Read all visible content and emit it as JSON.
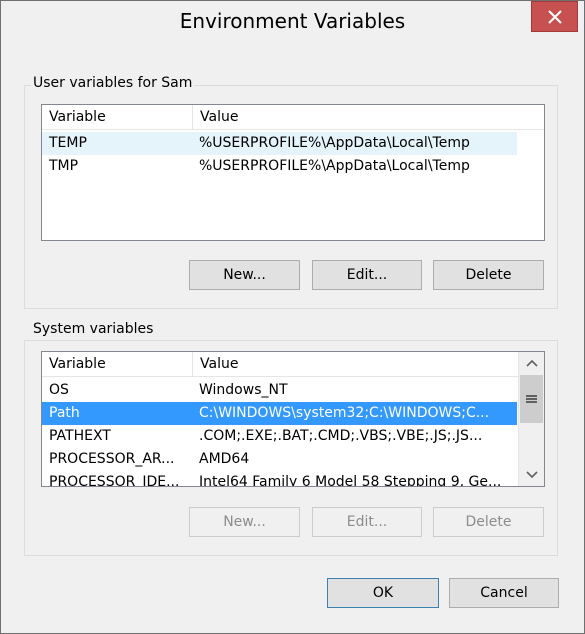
{
  "window": {
    "title": "Environment Variables"
  },
  "user_group": {
    "label": "User variables for Sam",
    "columns": [
      "Variable",
      "Value"
    ],
    "rows": [
      {
        "variable": "TEMP",
        "value": "%USERPROFILE%\\AppData\\Local\\Temp"
      },
      {
        "variable": "TMP",
        "value": "%USERPROFILE%\\AppData\\Local\\Temp"
      }
    ],
    "buttons": {
      "new": "New...",
      "edit": "Edit...",
      "delete": "Delete"
    }
  },
  "system_group": {
    "label": "System variables",
    "columns": [
      "Variable",
      "Value"
    ],
    "rows": [
      {
        "variable": "OS",
        "value": "Windows_NT"
      },
      {
        "variable": "Path",
        "value": "C:\\WINDOWS\\system32;C:\\WINDOWS;C..."
      },
      {
        "variable": "PATHEXT",
        "value": ".COM;.EXE;.BAT;.CMD;.VBS;.VBE;.JS;.JS..."
      },
      {
        "variable": "PROCESSOR_AR...",
        "value": "AMD64"
      },
      {
        "variable": "PROCESSOR_IDE...",
        "value": "Intel64 Family 6 Model 58 Stepping 9, Ge..."
      }
    ],
    "buttons": {
      "new": "New...",
      "edit": "Edit...",
      "delete": "Delete"
    }
  },
  "footer": {
    "ok": "OK",
    "cancel": "Cancel"
  },
  "colors": {
    "selection": "#3399ff",
    "hover": "#e5f3fb",
    "close": "#c75050"
  }
}
